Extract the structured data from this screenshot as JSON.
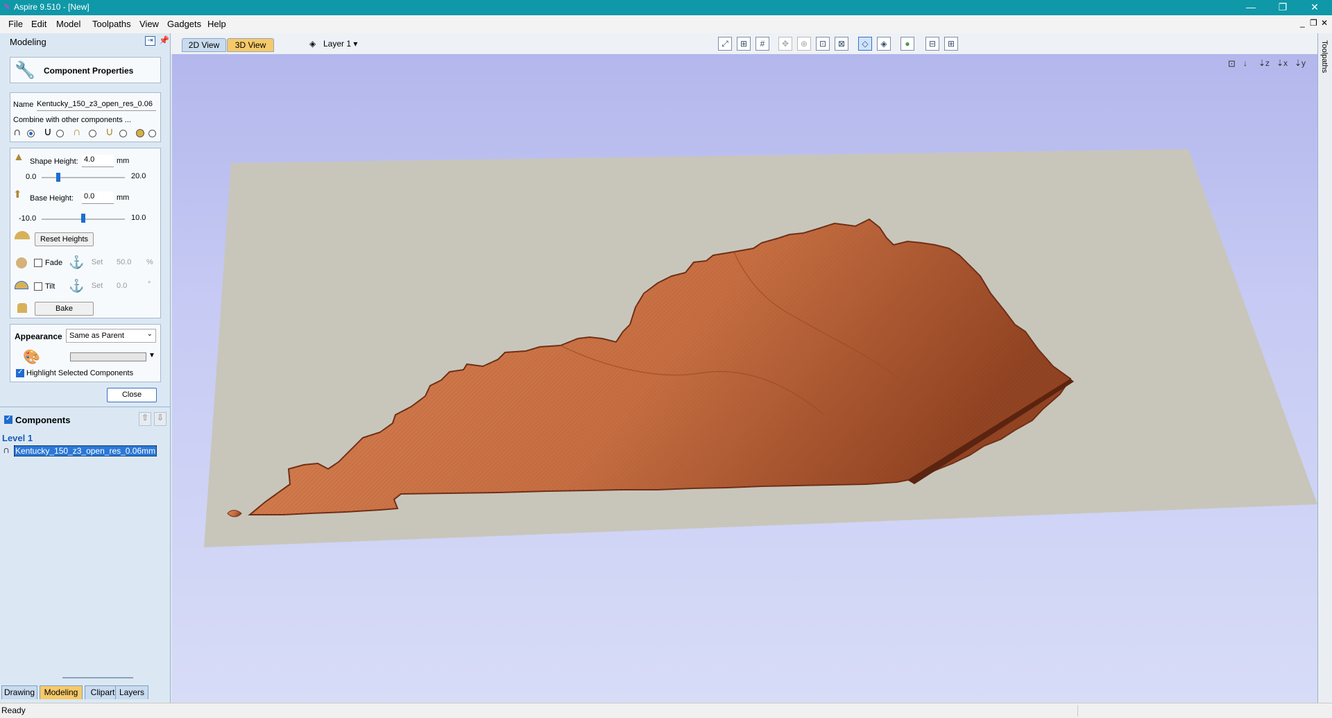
{
  "window": {
    "title": "Aspire 9.510 - [New]"
  },
  "menu": [
    "File",
    "Edit",
    "Model",
    "Toolpaths",
    "View",
    "Gadgets",
    "Help"
  ],
  "panel": {
    "title": "Modeling",
    "header": "Component Properties",
    "name_label": "Name",
    "name_value": "Kentucky_150_z3_open_res_0.06",
    "combine_label": "Combine with other components ...",
    "shape_height_label": "Shape Height:",
    "shape_height_value": "4.0",
    "shape_height_unit": "mm",
    "shape_min": "0.0",
    "shape_max": "20.0",
    "shape_level": 0.2,
    "base_height_label": "Base Height:",
    "base_height_value": "0.0",
    "base_height_unit": "mm",
    "base_min": "-10.0",
    "base_max": "10.0",
    "base_level": 0.5,
    "reset_heights": "Reset Heights",
    "fade_label": "Fade",
    "fade_set": "Set",
    "fade_value": "50.0",
    "fade_unit": "%",
    "tilt_label": "Tilt",
    "tilt_set": "Set",
    "tilt_value": "0.0",
    "tilt_unit": "°",
    "bake": "Bake",
    "appearance_label": "Appearance",
    "appearance_value": "Same as Parent",
    "highlight_label": "Highlight Selected Components",
    "close": "Close"
  },
  "components": {
    "title": "Components",
    "level": "Level 1",
    "item": "Kentucky_150_z3_open_res_0.06mm"
  },
  "bottom_tabs": [
    "Drawing",
    "Modeling",
    "Clipart",
    "Layers"
  ],
  "view_tabs": [
    "2D View",
    "3D View"
  ],
  "layer_label": "Layer 1",
  "right_strip_label": "Toolpaths",
  "status": "Ready",
  "colors": {
    "titlebar": "#0e98a8",
    "model": "#c86a40",
    "plate": "#c8c6bb",
    "active_tab": "#f6c96a"
  }
}
